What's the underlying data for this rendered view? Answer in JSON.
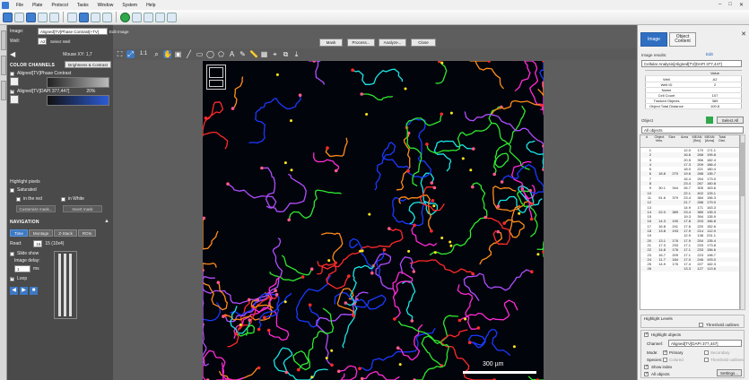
{
  "menubar": {
    "items": [
      "File",
      "Plate",
      "Protocol",
      "Tasks",
      "Window",
      "System",
      "Help"
    ]
  },
  "top_controls": {
    "image_label": "Image:",
    "image_value": "Aligned[TV]Phase Contrast[+TV]",
    "edit_image": "Edit Image",
    "well_label": "Well:",
    "well_value": "A2",
    "select_well": "Select Well",
    "buttons": [
      "Mask",
      "Process...",
      "Analyze...",
      "Close"
    ]
  },
  "left_panel": {
    "mouse_xy": "Mouse XY:  1,7",
    "color_channels_title": "COLOR CHANNELS",
    "brightness_btn": "Brightness & Contrast",
    "channel1_label": "Aligned[TV]Phase Contrast",
    "channel2_label": "Aligned[TV]DAPI 377,447]",
    "channel2_pct": "20%",
    "highlight_title": "Highlight pixels",
    "saturated": "Saturated",
    "in_the_red": "in the red",
    "in_white": "in White",
    "customize": "Customize mask...",
    "invert": "Invert mask",
    "navigation_title": "NAVIGATION",
    "nav_tabs": [
      "Time",
      "Montage",
      "Z-Stack",
      "ROIs"
    ],
    "read_label": "Read:",
    "read_value": "15",
    "read_total": "15 (10x4)",
    "slide_show": "Slide show",
    "image_delay": "Image delay:",
    "delay_value": "1",
    "delay_unit": "ms",
    "loop": "Loop"
  },
  "view_toolbar": {
    "ratio": "1:1"
  },
  "image": {
    "scale_text": "300 µm"
  },
  "right_panel": {
    "tabs": [
      "Image",
      "Object Content"
    ],
    "results_label": "Image results:",
    "results_value": "Cellular Analysis[Aligned[TV]DAPI 377,447]",
    "edit": "Edit",
    "info_header": [
      "",
      "Value"
    ],
    "info_rows": [
      [
        "Well",
        "A2"
      ],
      [
        "Well ID",
        "2"
      ],
      [
        "Name",
        ""
      ],
      [
        "Cell Count",
        "107"
      ],
      [
        "Tracked Objects",
        "389"
      ],
      [
        "Object Total Distance",
        "109.8"
      ]
    ],
    "object_label": "Object",
    "select_all": "Select All",
    "object_combo": "All objects",
    "table_header": [
      "#",
      "Object Velo.",
      "Size",
      "Area",
      "MEAN [Sec]",
      "MEAN [Area]",
      "Total Dist."
    ],
    "table_rows": [
      [
        "1",
        "",
        "",
        "12.0",
        "170",
        "171.1"
      ],
      [
        "2",
        "",
        "",
        "16.6",
        "268",
        "195.8"
      ],
      [
        "3",
        "",
        "",
        "20.5",
        "356",
        "182.4"
      ],
      [
        "4",
        "",
        "",
        "17.3",
        "209",
        "186.4"
      ],
      [
        "5",
        "",
        "",
        "18.0",
        "221",
        "180.4"
      ],
      [
        "6",
        "18.8",
        "270",
        "19.6",
        "288",
        "135.7"
      ],
      [
        "7",
        "",
        "",
        "16.4",
        "254",
        "173.0"
      ],
      [
        "8",
        "",
        "",
        "23.4",
        "267",
        "160.8"
      ],
      [
        "9",
        "30.1",
        "344",
        "26.7",
        "305",
        "163.6"
      ],
      [
        "10",
        "",
        "",
        "22.1",
        "402",
        "125.1"
      ],
      [
        "11",
        "51.6",
        "379",
        "23.4",
        "384",
        "156.3"
      ],
      [
        "12",
        "",
        "",
        "21.7",
        "288",
        "179.0"
      ],
      [
        "13",
        "",
        "",
        "14.9",
        "171",
        "163.3"
      ],
      [
        "14",
        "22.0",
        "389",
        "23.4",
        "389",
        "135.3"
      ],
      [
        "15",
        "",
        "",
        "19.3",
        "394",
        "135.9"
      ],
      [
        "16",
        "14.3",
        "190",
        "17.8",
        "203",
        "166.8"
      ],
      [
        "17",
        "16.8",
        "241",
        "17.6",
        "220",
        "152.6"
      ],
      [
        "18",
        "13.8",
        "193",
        "17.9",
        "214",
        "112.0"
      ],
      [
        "19",
        "",
        "",
        "12.9",
        "138",
        "231.1"
      ],
      [
        "20",
        "13.1",
        "176",
        "17.9",
        "254",
        "135.4"
      ],
      [
        "21",
        "17.3",
        "233",
        "17.1",
        "233",
        "173.8"
      ],
      [
        "22",
        "14.8",
        "176",
        "17.1",
        "233",
        "156.6"
      ],
      [
        "23",
        "16.7",
        "209",
        "17.1",
        "223",
        "198.7"
      ],
      [
        "24",
        "11.7",
        "184",
        "17.0",
        "246",
        "193.0"
      ],
      [
        "25",
        "14.9",
        "176",
        "17.4",
        "227",
        "162.3"
      ],
      [
        "26",
        "",
        "",
        "13.3",
        "127",
        "113.6"
      ]
    ],
    "highlight_label": "Highlight Levels",
    "threshold_outlines": "Threshold outlines",
    "highlight_objects": "Highlight objects",
    "channel_label": "Channel:",
    "channel_value": "Aligned[TV]DAPI 377,447]",
    "mode_label": "Mode:",
    "primary": "Primary",
    "secondary": "Secondary",
    "species_label": "Species:",
    "colored": "Colored",
    "threshold_outlines2": "Threshold outlines",
    "show_index": "Show index",
    "all_objects": "All objects",
    "settings": "Settings..."
  },
  "colors": {
    "accent": "#3d78c2",
    "canvas": "#02040b"
  },
  "tracks": {
    "colors": [
      "#ff2a2a",
      "#2fe82f",
      "#1a39ff",
      "#19e6e6",
      "#ff8c1a",
      "#ff2bd6",
      "#b04dff",
      "#ffe81a"
    ]
  }
}
